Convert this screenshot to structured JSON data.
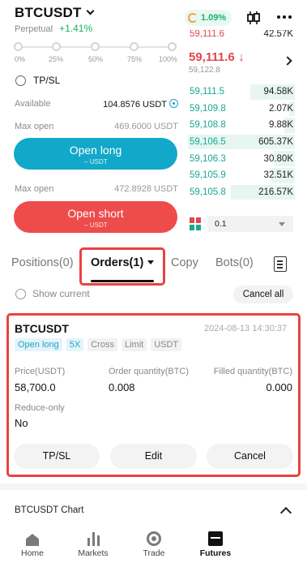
{
  "header": {
    "symbol": "BTCUSDT",
    "type": "Perpetual",
    "change": "+1.41%",
    "badge": "1.09%"
  },
  "slider": {
    "labels": [
      "0%",
      "25%",
      "50%",
      "75%",
      "100%"
    ]
  },
  "form": {
    "tpsl_label": "TP/SL",
    "available_label": "Available",
    "available_value": "104.8576 USDT",
    "max_open_label_long": "Max open",
    "max_open_value_long": "469.6000 USDT",
    "open_long_label": "Open long",
    "open_long_sub": "-- USDT",
    "max_open_label_short": "Max open",
    "max_open_value_short": "472.8928 USDT",
    "open_short_label": "Open short",
    "open_short_sub": "-- USDT"
  },
  "order_book": {
    "asks": [
      {
        "price": "59,111.6",
        "qty": "42.57K"
      }
    ],
    "mid_price": "59,111.6",
    "mid_arrow": "↓",
    "mid_sub": "59,122.8",
    "bids": [
      {
        "price": "59,111.5",
        "qty": "94.58K",
        "depth": 0.42
      },
      {
        "price": "59,109.8",
        "qty": "2.07K",
        "depth": 0.05
      },
      {
        "price": "59,108.8",
        "qty": "9.88K",
        "depth": 0.1
      },
      {
        "price": "59,106.5",
        "qty": "605.37K",
        "depth": 1.0
      },
      {
        "price": "59,106.3",
        "qty": "30.80K",
        "depth": 0.2
      },
      {
        "price": "59,105.9",
        "qty": "32.51K",
        "depth": 0.22
      },
      {
        "price": "59,105.8",
        "qty": "216.57K",
        "depth": 0.6
      }
    ],
    "depth_value": "0.1"
  },
  "tabs": {
    "positions": "Positions(0)",
    "orders": "Orders(1)",
    "copy": "Copy",
    "bots": "Bots(0)"
  },
  "filter": {
    "show_current": "Show current",
    "cancel_all": "Cancel all"
  },
  "order": {
    "symbol": "BTCUSDT",
    "time": "2024-08-13 14:30:37",
    "tags": [
      "Open long",
      "5X",
      "Cross",
      "Limit",
      "USDT"
    ],
    "price_label": "Price(USDT)",
    "price_value": "58,700.0",
    "qty_label": "Order quantity(BTC)",
    "qty_value": "0.008",
    "filled_label": "Filled quantity(BTC)",
    "filled_value": "0.000",
    "reduce_label": "Reduce-only",
    "reduce_value": "No",
    "btn_tpsl": "TP/SL",
    "btn_edit": "Edit",
    "btn_cancel": "Cancel"
  },
  "chart_section": {
    "label": "BTCUSDT  Chart"
  },
  "nav": {
    "home": "Home",
    "markets": "Markets",
    "trade": "Trade",
    "futures": "Futures"
  },
  "colors": {
    "long": "#12a8c9",
    "short": "#ee4b4b",
    "bid_green": "#17a88f",
    "ask_red": "#e0474c",
    "highlight_red": "#e84343"
  }
}
